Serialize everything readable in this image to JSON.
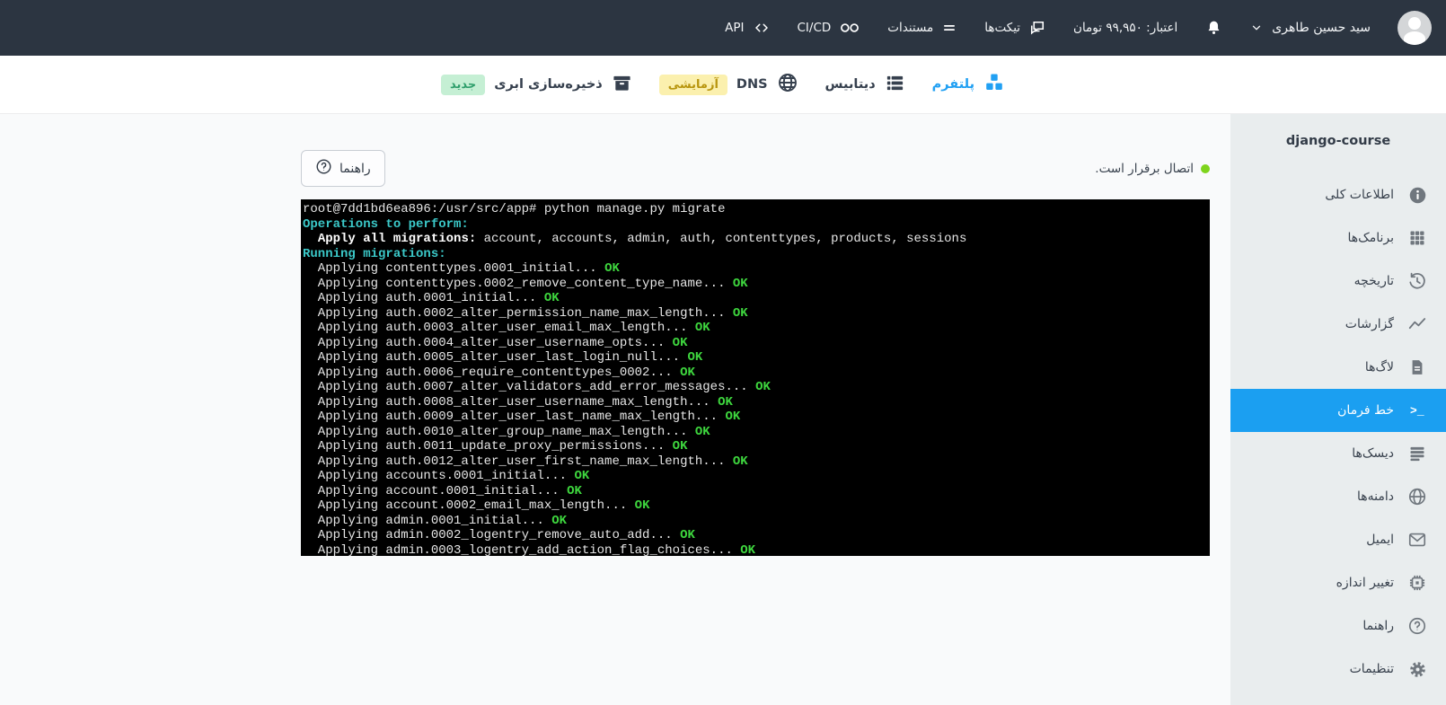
{
  "topnav": {
    "user_name": "سید حسین طاهری",
    "credit": "اعتبار: ۹۹,۹۵۰ تومان",
    "links": [
      {
        "label": "تیکت‌ها",
        "icon": "tickets-chat-icon"
      },
      {
        "label": "مستندات",
        "icon": "docs-lines-icon"
      },
      {
        "label": "CI/CD",
        "icon": "infinity-icon"
      },
      {
        "label": "API",
        "icon": "code-brackets-icon"
      }
    ]
  },
  "mainnav": {
    "items": [
      {
        "label": "پلتفرم",
        "icon": "cubes",
        "active": true
      },
      {
        "label": "دیتابیس",
        "icon": "database"
      },
      {
        "label": "DNS",
        "icon": "globe",
        "badge": "آزمایشی",
        "badge_color": "yellow"
      },
      {
        "label": "ذخیره‌سازی ابری",
        "icon": "archive-box",
        "badge": "جدید",
        "badge_color": "green"
      }
    ]
  },
  "sidebar": {
    "title": "django-course",
    "items": [
      {
        "key": "general-info",
        "label": "اطلاعات کلی",
        "icon": "info"
      },
      {
        "key": "apps",
        "label": "برنامک‌ها",
        "icon": "apps"
      },
      {
        "key": "history",
        "label": "تاریخچه",
        "icon": "history"
      },
      {
        "key": "reports",
        "label": "گزارشات",
        "icon": "chart"
      },
      {
        "key": "logs",
        "label": "لاگ‌ها",
        "icon": "doc"
      },
      {
        "key": "command-line",
        "label": "خط فرمان",
        "icon": "terminal",
        "active": true
      },
      {
        "key": "disks",
        "label": "دیسک‌ها",
        "icon": "disks"
      },
      {
        "key": "domains",
        "label": "دامنه‌ها",
        "icon": "globe"
      },
      {
        "key": "email",
        "label": "ایمیل",
        "icon": "mail"
      },
      {
        "key": "resize",
        "label": "تغییر اندازه",
        "icon": "chip"
      },
      {
        "key": "help",
        "label": "راهنما",
        "icon": "question"
      },
      {
        "key": "settings",
        "label": "تنظیمات",
        "icon": "gear"
      }
    ]
  },
  "main": {
    "status_text": "اتصال برقرار است.",
    "help_button_label": "راهنما",
    "terminal": {
      "lines": [
        [
          {
            "s": "p",
            "t": "root@7dd1bd6ea896:/usr/src/app# python manage.py migrate"
          }
        ],
        [
          {
            "s": "c",
            "t": "Operations to perform:"
          }
        ],
        [
          {
            "s": "p",
            "t": "  "
          },
          {
            "s": "b",
            "t": "Apply all migrations:"
          },
          {
            "s": "p",
            "t": " account, accounts, admin, auth, contenttypes, products, sessions"
          }
        ],
        [
          {
            "s": "c",
            "t": "Running migrations:"
          }
        ],
        [
          {
            "s": "p",
            "t": "  Applying contenttypes.0001_initial... "
          },
          {
            "s": "g",
            "t": "OK"
          }
        ],
        [
          {
            "s": "p",
            "t": "  Applying contenttypes.0002_remove_content_type_name... "
          },
          {
            "s": "g",
            "t": "OK"
          }
        ],
        [
          {
            "s": "p",
            "t": "  Applying auth.0001_initial... "
          },
          {
            "s": "g",
            "t": "OK"
          }
        ],
        [
          {
            "s": "p",
            "t": "  Applying auth.0002_alter_permission_name_max_length... "
          },
          {
            "s": "g",
            "t": "OK"
          }
        ],
        [
          {
            "s": "p",
            "t": "  Applying auth.0003_alter_user_email_max_length... "
          },
          {
            "s": "g",
            "t": "OK"
          }
        ],
        [
          {
            "s": "p",
            "t": "  Applying auth.0004_alter_user_username_opts... "
          },
          {
            "s": "g",
            "t": "OK"
          }
        ],
        [
          {
            "s": "p",
            "t": "  Applying auth.0005_alter_user_last_login_null... "
          },
          {
            "s": "g",
            "t": "OK"
          }
        ],
        [
          {
            "s": "p",
            "t": "  Applying auth.0006_require_contenttypes_0002... "
          },
          {
            "s": "g",
            "t": "OK"
          }
        ],
        [
          {
            "s": "p",
            "t": "  Applying auth.0007_alter_validators_add_error_messages... "
          },
          {
            "s": "g",
            "t": "OK"
          }
        ],
        [
          {
            "s": "p",
            "t": "  Applying auth.0008_alter_user_username_max_length... "
          },
          {
            "s": "g",
            "t": "OK"
          }
        ],
        [
          {
            "s": "p",
            "t": "  Applying auth.0009_alter_user_last_name_max_length... "
          },
          {
            "s": "g",
            "t": "OK"
          }
        ],
        [
          {
            "s": "p",
            "t": "  Applying auth.0010_alter_group_name_max_length... "
          },
          {
            "s": "g",
            "t": "OK"
          }
        ],
        [
          {
            "s": "p",
            "t": "  Applying auth.0011_update_proxy_permissions... "
          },
          {
            "s": "g",
            "t": "OK"
          }
        ],
        [
          {
            "s": "p",
            "t": "  Applying auth.0012_alter_user_first_name_max_length... "
          },
          {
            "s": "g",
            "t": "OK"
          }
        ],
        [
          {
            "s": "p",
            "t": "  Applying accounts.0001_initial... "
          },
          {
            "s": "g",
            "t": "OK"
          }
        ],
        [
          {
            "s": "p",
            "t": "  Applying account.0001_initial... "
          },
          {
            "s": "g",
            "t": "OK"
          }
        ],
        [
          {
            "s": "p",
            "t": "  Applying account.0002_email_max_length... "
          },
          {
            "s": "g",
            "t": "OK"
          }
        ],
        [
          {
            "s": "p",
            "t": "  Applying admin.0001_initial... "
          },
          {
            "s": "g",
            "t": "OK"
          }
        ],
        [
          {
            "s": "p",
            "t": "  Applying admin.0002_logentry_remove_auto_add... "
          },
          {
            "s": "g",
            "t": "OK"
          }
        ],
        [
          {
            "s": "p",
            "t": "  Applying admin.0003_logentry_add_action_flag_choices... "
          },
          {
            "s": "g",
            "t": "OK"
          }
        ]
      ]
    }
  },
  "colors": {
    "topnav_bg": "#2c3541",
    "sidebar_bg": "#e9edee",
    "accent_blue": "#1b9ff1",
    "status_dot_green": "#7ed41c",
    "terminal_cyan": "#3bc9c9",
    "terminal_green": "#3ed63e",
    "badge_yellow_bg": "#fbf0ae",
    "badge_green_bg": "#c5efd4"
  }
}
